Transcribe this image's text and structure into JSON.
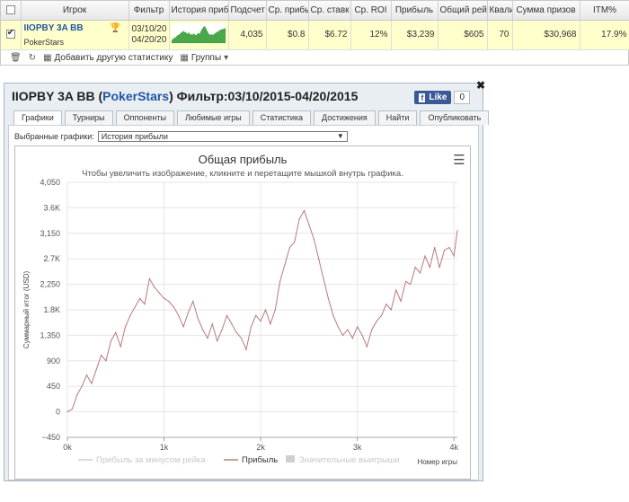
{
  "stats_table": {
    "headers": [
      "",
      "Игрок",
      "Фильтр",
      "История прибы",
      "Подсчет",
      "Ср. прибы",
      "Ср. ставк",
      "Ср. ROI",
      "Прибыль",
      "Общий рейк",
      "Квали",
      "Сумма призов",
      "ITM%"
    ],
    "row": {
      "checked": true,
      "player": "IIOPBY 3A BB",
      "site": "PokerStars",
      "filter_from": "03/10/20",
      "filter_to": "04/20/20",
      "count": "4,035",
      "avg_profit": "$0.8",
      "avg_stake": "$6.72",
      "avg_roi": "12%",
      "profit": "$3,239",
      "total_rake": "$605",
      "qual": "70",
      "prize_sum": "$30,968",
      "itm": "17.9%"
    }
  },
  "toolbar": {
    "add_stats_label": "Добавить другую статистику",
    "groups_label": "Группы"
  },
  "window": {
    "player": "IIOPBY 3A BB",
    "site": "PokerStars",
    "filter_text": "Фильтр:03/10/2015-04/20/2015",
    "fb_like": "Like",
    "fb_count": "0",
    "tabs": [
      "Графики",
      "Турниры",
      "Оппоненты",
      "Любимые игры",
      "Статистика",
      "Достижения",
      "Найти",
      "Опубликовать"
    ],
    "active_tab": 0,
    "selector_label": "Выбранные графики:",
    "selector_value": "История прибыли"
  },
  "chart_data": {
    "type": "line",
    "title": "Общая прибыль",
    "subtitle": "Чтобы увеличить изображение, кликните и перетащите мышкой внутрь графика.",
    "ylabel": "Суммарный итог (USD)",
    "xlabel": "Номер игры",
    "ylim": [
      -450,
      4050
    ],
    "xlim": [
      0,
      4035
    ],
    "y_ticks": [
      "−450",
      "0",
      "450",
      "900",
      "1,350",
      "1.8K",
      "2,250",
      "2.7K",
      "3,150",
      "3.6K",
      "4,050"
    ],
    "y_tick_values": [
      -450,
      0,
      450,
      900,
      1350,
      1800,
      2250,
      2700,
      3150,
      3600,
      4050
    ],
    "x_ticks": [
      "0k",
      "1k",
      "2k",
      "3k",
      "4k"
    ],
    "x_tick_values": [
      0,
      1000,
      2000,
      3000,
      4000
    ],
    "grid": true,
    "legend": [
      "Прибыль за минусом рейка",
      "Прибыль",
      "Значительные выигрыши"
    ],
    "series": [
      {
        "name": "Прибыль",
        "color": "#b87a7a",
        "x": [
          0,
          50,
          100,
          150,
          200,
          250,
          300,
          350,
          400,
          450,
          500,
          550,
          600,
          650,
          700,
          750,
          800,
          850,
          900,
          950,
          1000,
          1050,
          1100,
          1150,
          1200,
          1250,
          1300,
          1350,
          1400,
          1450,
          1500,
          1550,
          1600,
          1650,
          1700,
          1750,
          1800,
          1850,
          1900,
          1950,
          2000,
          2050,
          2100,
          2150,
          2200,
          2250,
          2300,
          2350,
          2400,
          2450,
          2500,
          2550,
          2600,
          2650,
          2700,
          2750,
          2800,
          2850,
          2900,
          2950,
          3000,
          3050,
          3100,
          3150,
          3200,
          3250,
          3300,
          3350,
          3400,
          3450,
          3500,
          3550,
          3600,
          3650,
          3700,
          3750,
          3800,
          3850,
          3900,
          3950,
          4000,
          4035
        ],
        "values": [
          0,
          50,
          300,
          450,
          650,
          500,
          750,
          1000,
          900,
          1250,
          1400,
          1150,
          1500,
          1700,
          1850,
          2000,
          1900,
          2350,
          2200,
          2100,
          2000,
          1950,
          1850,
          1700,
          1500,
          1750,
          1950,
          1650,
          1450,
          1300,
          1550,
          1250,
          1450,
          1700,
          1550,
          1400,
          1300,
          1100,
          1500,
          1700,
          1600,
          1800,
          1550,
          1800,
          2300,
          2600,
          2900,
          3000,
          3400,
          3550,
          3300,
          3050,
          2700,
          2350,
          2000,
          1700,
          1500,
          1350,
          1450,
          1300,
          1500,
          1350,
          1150,
          1450,
          1600,
          1700,
          1900,
          1800,
          2150,
          1950,
          2300,
          2250,
          2550,
          2450,
          2750,
          2550,
          2900,
          2550,
          2850,
          2900,
          2750,
          3200
        ]
      }
    ]
  }
}
